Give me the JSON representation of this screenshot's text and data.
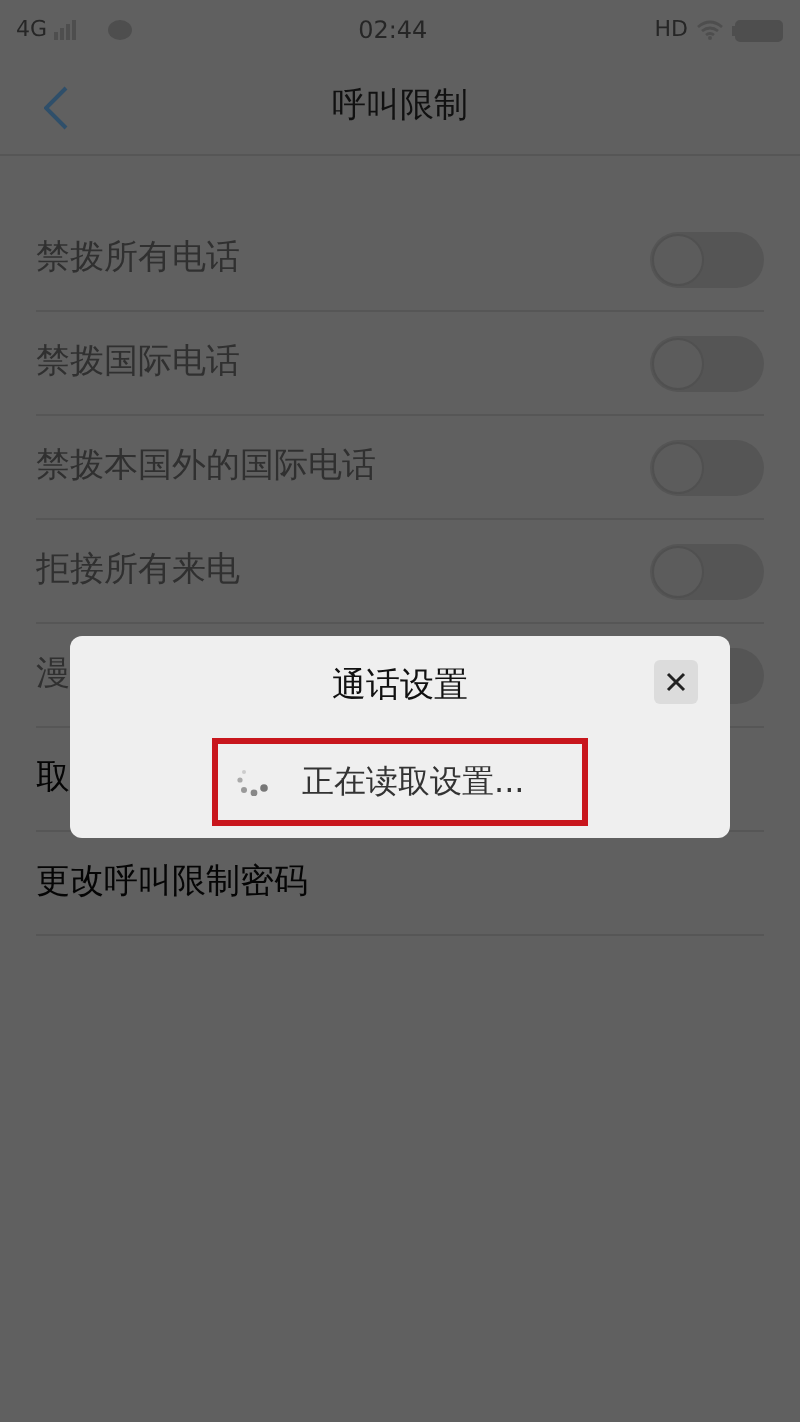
{
  "status_bar": {
    "network": "4G",
    "time": "02:44",
    "hd": "HD"
  },
  "header": {
    "title": "呼叫限制"
  },
  "rows": [
    {
      "kind": "toggle",
      "label": "禁拨所有电话",
      "on": false,
      "disabled": true
    },
    {
      "kind": "toggle",
      "label": "禁拨国际电话",
      "on": false,
      "disabled": true
    },
    {
      "kind": "toggle",
      "label": "禁拨本国外的国际电话",
      "on": false,
      "disabled": true
    },
    {
      "kind": "toggle",
      "label": "拒接所有来电",
      "on": false,
      "disabled": true
    },
    {
      "kind": "toggle",
      "label": "漫",
      "on": false,
      "disabled": true
    },
    {
      "kind": "link",
      "label": "取",
      "disabled": false
    },
    {
      "kind": "link",
      "label": "更改呼叫限制密码",
      "disabled": false
    }
  ],
  "dialog": {
    "title": "通话设置",
    "message": "正在读取设置..."
  }
}
